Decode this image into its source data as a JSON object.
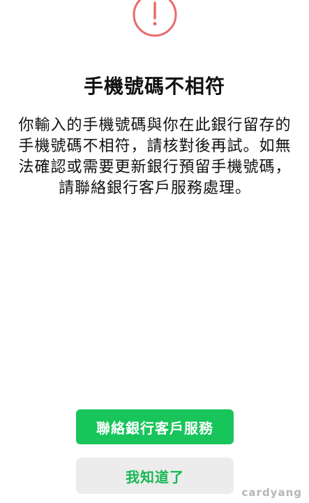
{
  "dialog": {
    "icon": "alert-circle-icon",
    "icon_color": "#e86a6a",
    "title": "手機號碼不相符",
    "message": "你輸入的手機號碼與你在此銀行留存的手機號碼不相符，請核對後再試。如無法確認或需要更新銀行預留手機號碼，請聯絡銀行客戶服務處理。"
  },
  "actions": {
    "primary_label": "聯絡銀行客戶服務",
    "secondary_label": "我知道了",
    "primary_color": "#17c55a",
    "secondary_text_color": "#17b855"
  },
  "watermark": "cardyang"
}
